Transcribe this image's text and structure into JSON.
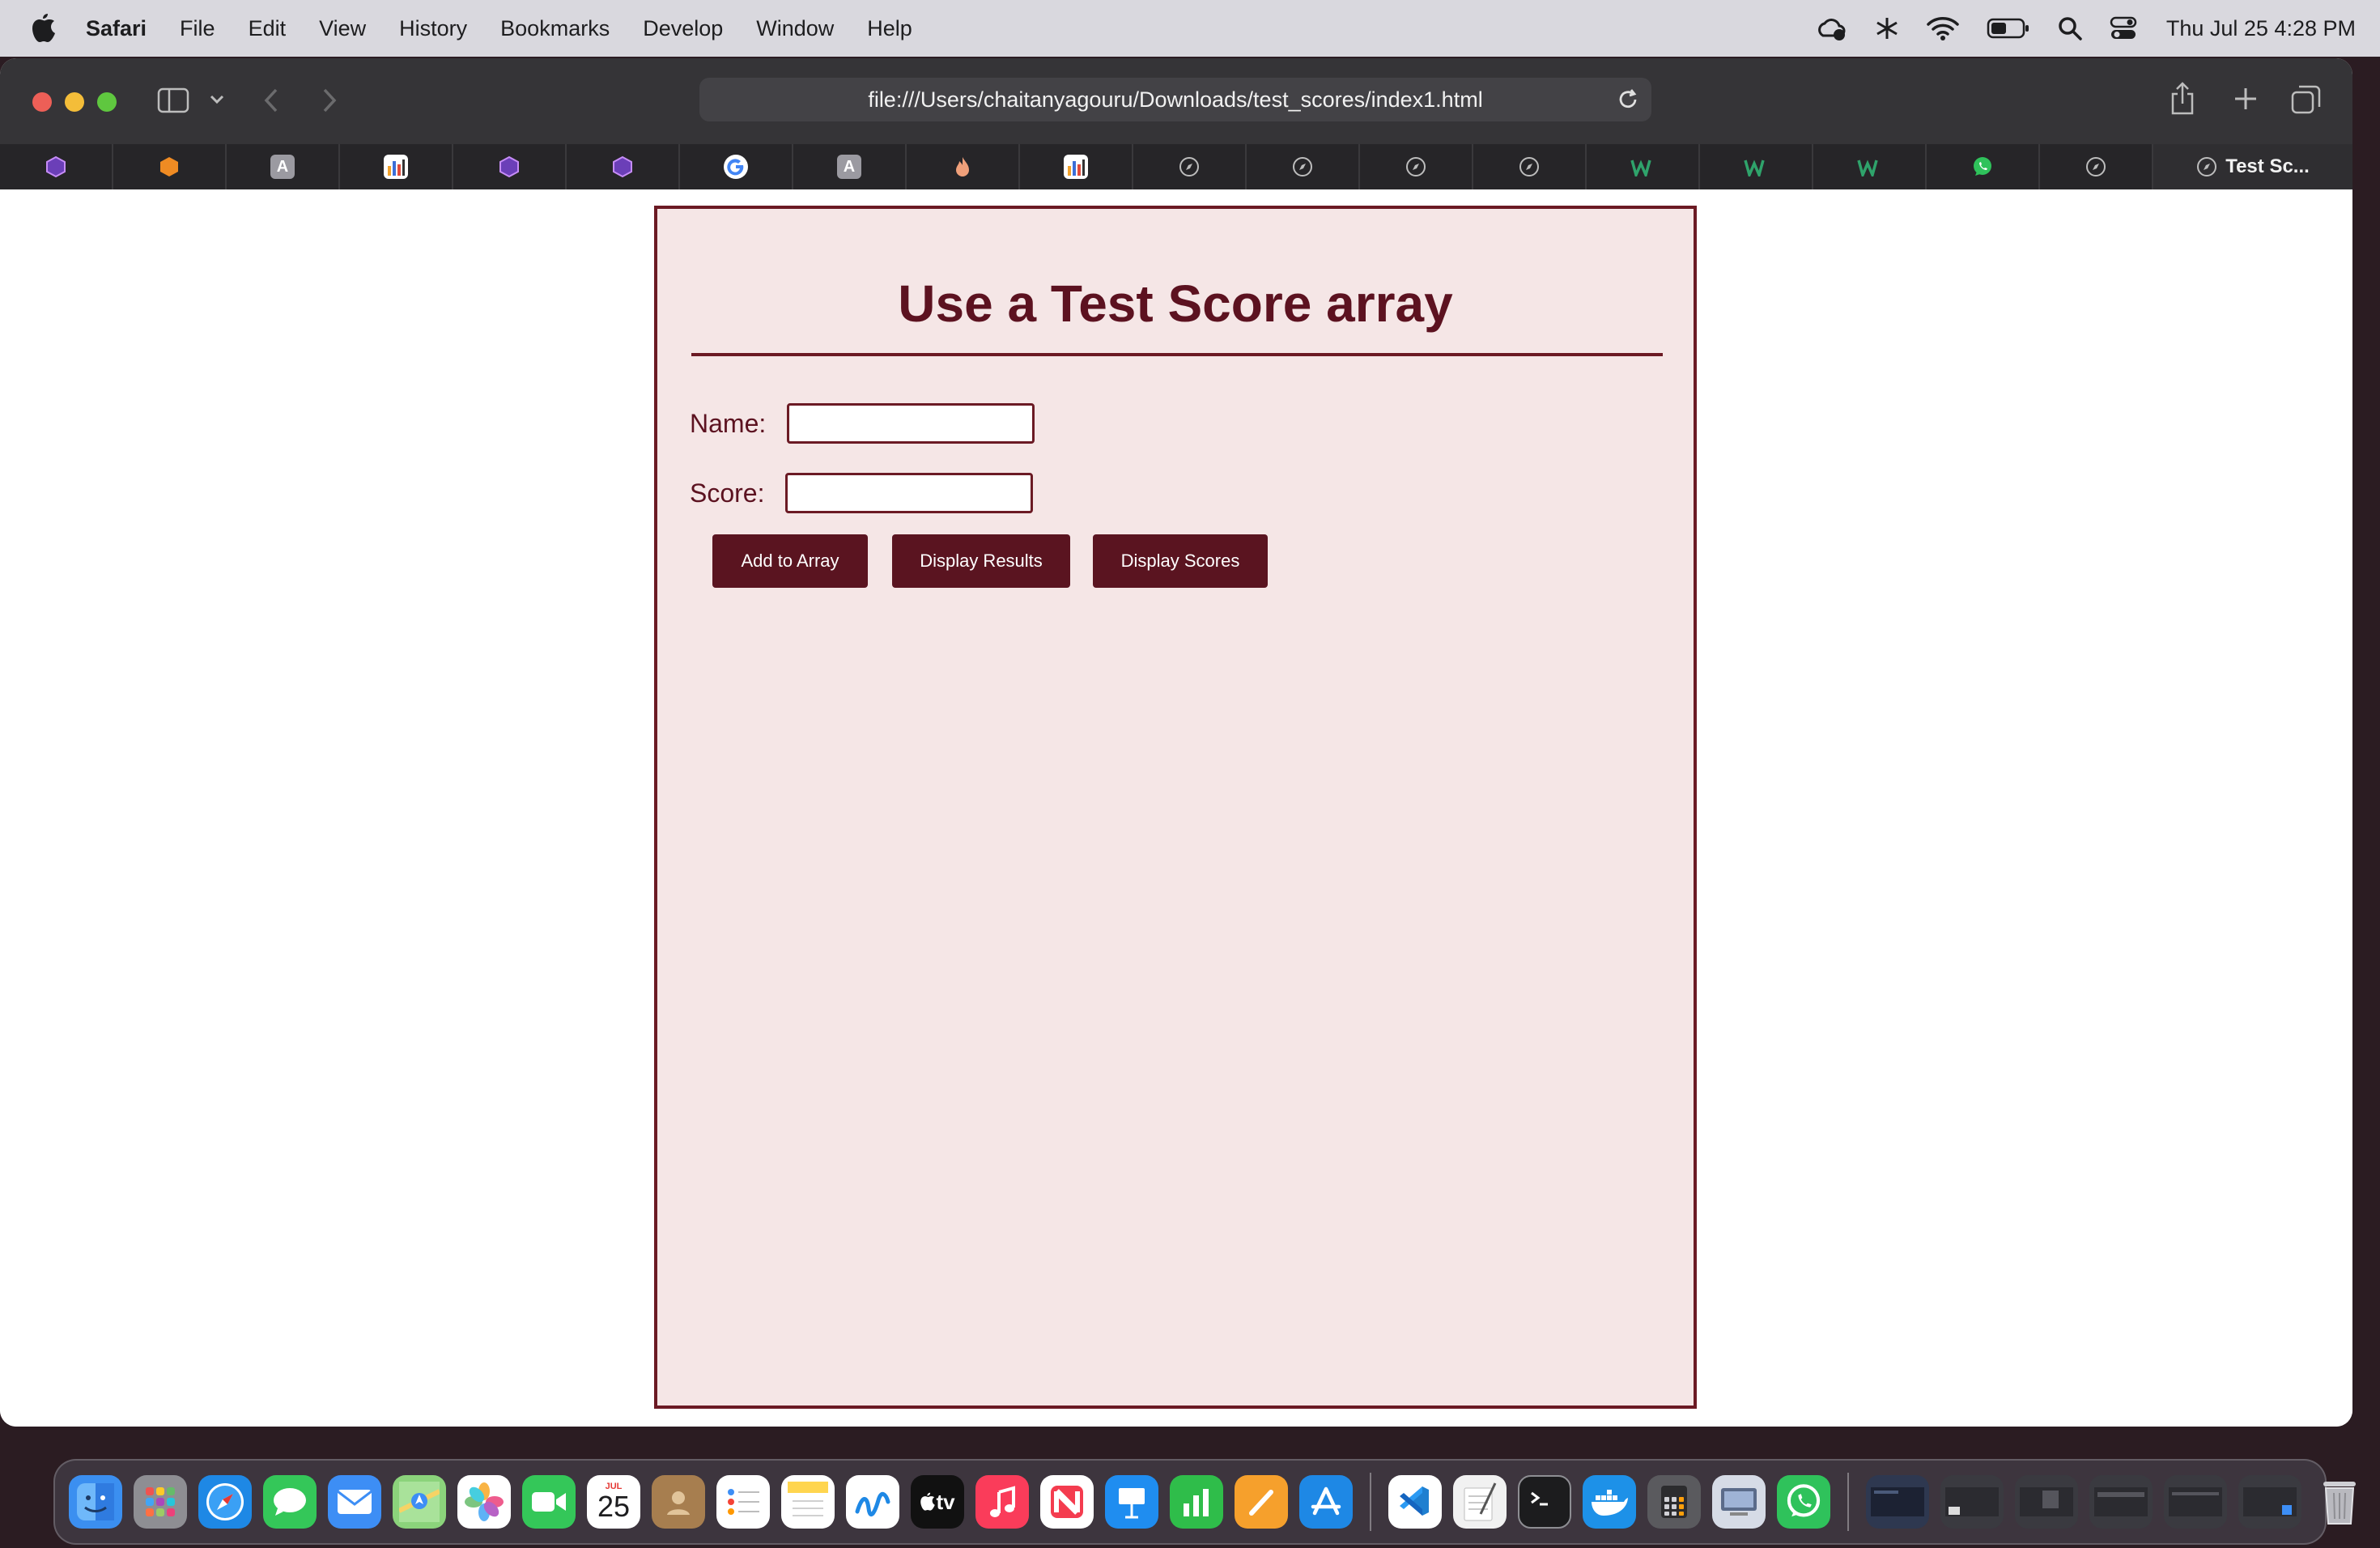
{
  "menubar": {
    "app_name": "Safari",
    "menus": [
      "File",
      "Edit",
      "View",
      "History",
      "Bookmarks",
      "Develop",
      "Window",
      "Help"
    ],
    "clock": "Thu Jul 25  4:28 PM"
  },
  "browser": {
    "url": "file:///Users/chaitanyagouru/Downloads/test_scores/index1.html",
    "active_tab_title": "Test Sc..."
  },
  "page": {
    "title": "Use a Test Score array",
    "name_label": "Name:",
    "name_value": "",
    "score_label": "Score:",
    "score_value": "",
    "add_button": "Add to Array",
    "results_button": "Display Results",
    "scores_button": "Display Scores"
  },
  "dock": {
    "calendar_month": "JUL",
    "calendar_day": "25",
    "tv_label": "tv"
  },
  "colors": {
    "accent": "#5a1420",
    "panel": "#f5e6e6"
  }
}
